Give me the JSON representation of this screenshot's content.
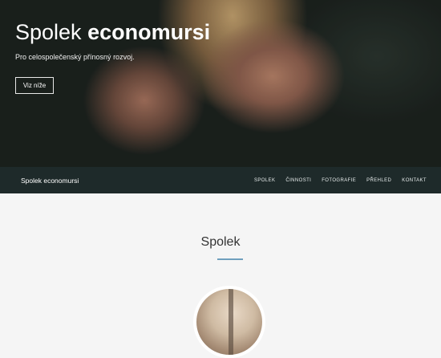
{
  "hero": {
    "title_prefix": "Spolek",
    "title_strong": "economursi",
    "subtitle": "Pro celospolečenský přínosný rozvoj.",
    "button_label": "Viz níže"
  },
  "navbar": {
    "brand": "Spolek economursi",
    "items": [
      "SPOLEK",
      "ČINNOSTI",
      "FOTOGRAFIE",
      "PŘEHLED",
      "KONTAKT"
    ]
  },
  "section": {
    "title": "Spolek"
  },
  "colors": {
    "navbar": "#1e2a2a",
    "accent": "#6f9fbd",
    "background": "#f5f5f5"
  }
}
